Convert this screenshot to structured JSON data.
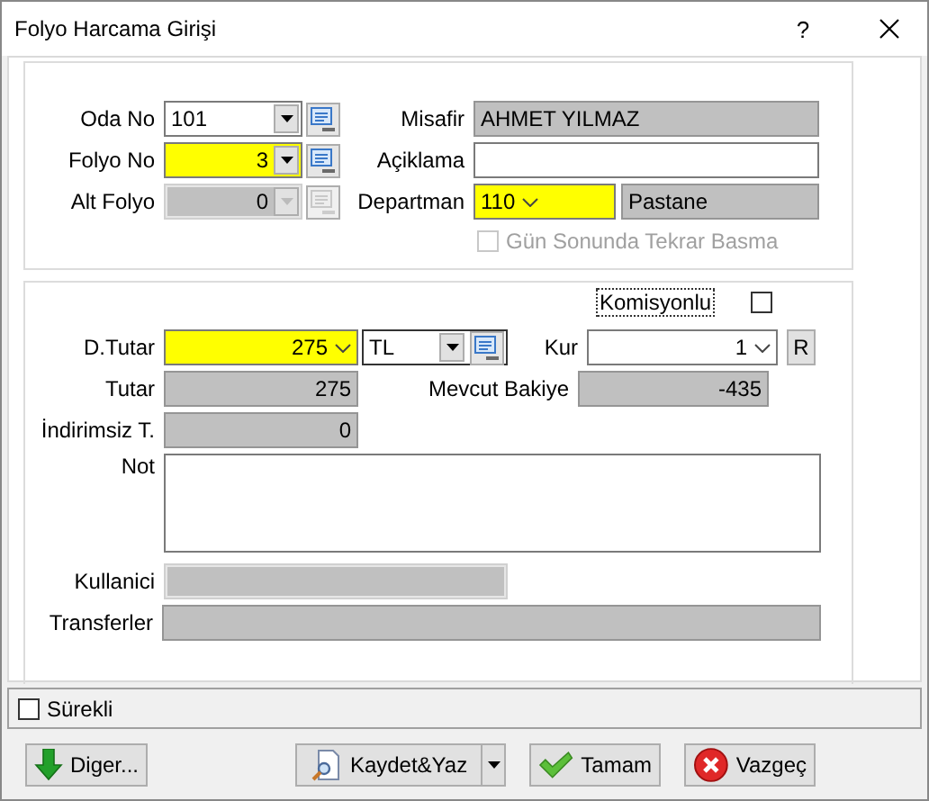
{
  "window": {
    "title": "Folyo Harcama Girişi",
    "help": "?"
  },
  "guest": {
    "room": {
      "label": "Oda No",
      "value": "101",
      "highlighted": false,
      "read_only": false,
      "disabled": false
    },
    "folio": {
      "label": "Folyo No",
      "value": "3",
      "highlighted": true,
      "read_only": false,
      "disabled": false
    },
    "sub_folio": {
      "label": "Alt Folyo",
      "value": "0",
      "highlighted": false,
      "read_only": false,
      "disabled": true
    },
    "guest_name": {
      "label": "Misafir",
      "value": "AHMET YILMAZ",
      "highlighted": false,
      "read_only": true,
      "disabled": false
    },
    "description": {
      "label": "Açiklama",
      "highlighted": false,
      "read_only": false,
      "disabled": false
    },
    "department": {
      "label": "Departman",
      "value": "110",
      "highlighted": true,
      "read_only": false,
      "disabled": false,
      "name": "Pastane"
    },
    "reprint": {
      "label": "Gün Sonunda Tekrar Basma",
      "checked": false,
      "disabled": true
    }
  },
  "amount": {
    "commission": {
      "label": "Komisyonlu",
      "checked": false
    },
    "foreign_amount": {
      "label": "D.Tutar",
      "value": "275",
      "highlighted": true,
      "read_only": false,
      "disabled": false
    },
    "currency": {
      "value": "TL",
      "highlighted": false,
      "read_only": false,
      "disabled": false
    },
    "rate": {
      "label": "Kur",
      "value": "1",
      "highlighted": false,
      "read_only": false,
      "disabled": false
    },
    "rate_button": "R",
    "total": {
      "label": "Tutar",
      "value": "275",
      "highlighted": false,
      "read_only": true,
      "disabled": false
    },
    "balance": {
      "label": "Mevcut Bakiye",
      "value": "-435",
      "highlighted": false,
      "read_only": true,
      "disabled": false
    },
    "gross": {
      "label": "İndirimsiz T.",
      "value": "0",
      "highlighted": false,
      "read_only": true,
      "disabled": false
    },
    "note": {
      "label": "Not",
      "highlighted": false,
      "read_only": false,
      "disabled": false
    },
    "user": {
      "label": "Kullanici",
      "highlighted": false,
      "read_only": false,
      "disabled": true
    },
    "transfers": {
      "label": "Transferler",
      "highlighted": false,
      "read_only": true,
      "disabled": false
    }
  },
  "continuous": {
    "label": "Sürekli",
    "checked": false
  },
  "buttons": [
    {
      "label": "Diger...",
      "kind": "other"
    },
    {
      "label": "Kaydet&Yaz",
      "kind": "save_print"
    },
    {
      "label": "Tamam",
      "kind": "ok"
    },
    {
      "label": "Vazgeç",
      "kind": "cancel"
    }
  ]
}
